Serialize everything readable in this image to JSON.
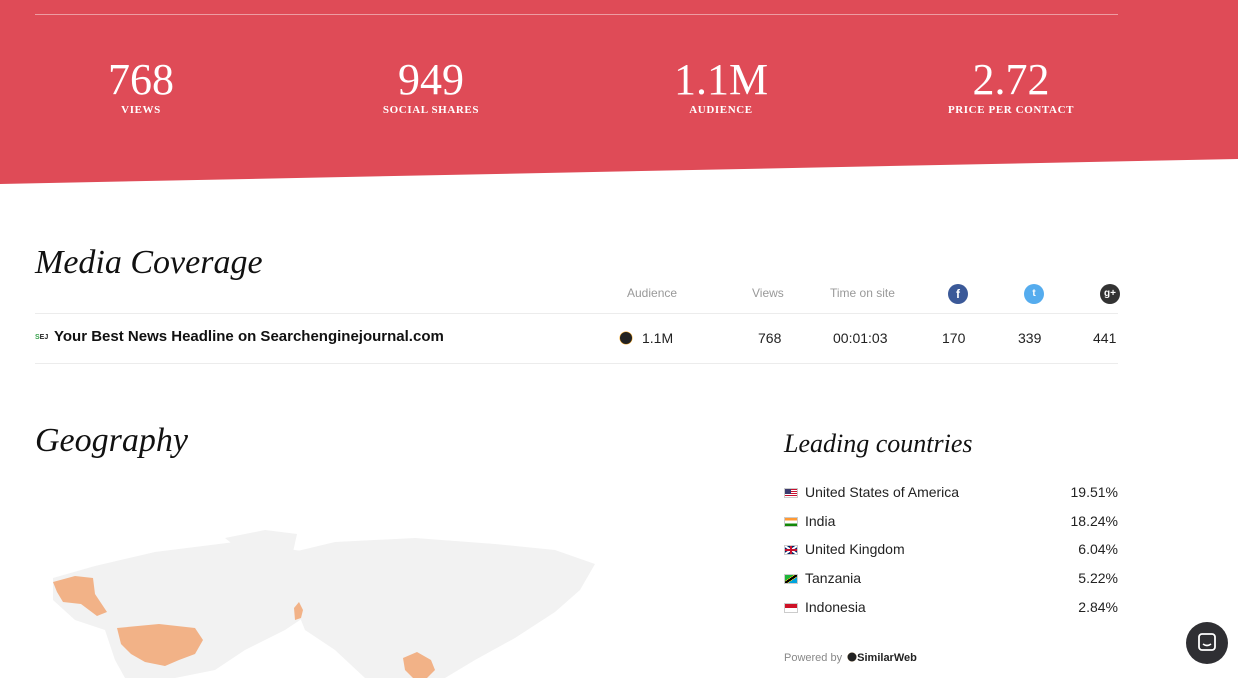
{
  "stats": [
    {
      "value": "768",
      "label": "VIEWS"
    },
    {
      "value": "949",
      "label": "SOCIAL SHARES"
    },
    {
      "value": "1.1M",
      "label": "AUDIENCE"
    },
    {
      "value": "2.72",
      "label": "PRICE PER CONTACT"
    }
  ],
  "colors": {
    "hero": "#df4b57",
    "map_land": "#f2f2f2",
    "map_highlight": "#f2b287"
  },
  "media": {
    "title": "Media Coverage",
    "headers": {
      "audience": "Audience",
      "views": "Views",
      "time": "Time on site",
      "facebook": "facebook-icon",
      "twitter": "twitter-icon",
      "google": "google-plus-icon"
    },
    "row": {
      "badge": "SEJ",
      "title": "Your Best News Headline on Searchenginejournal.com",
      "audience": "1.1M",
      "views": "768",
      "time": "00:01:03",
      "facebook": "170",
      "twitter": "339",
      "google": "441"
    }
  },
  "geography": {
    "title": "Geography",
    "leading_title": "Leading countries",
    "countries": [
      {
        "name": "United States of America",
        "pct": "19.51%"
      },
      {
        "name": "India",
        "pct": "18.24%"
      },
      {
        "name": "United Kingdom",
        "pct": "6.04%"
      },
      {
        "name": "Tanzania",
        "pct": "5.22%"
      },
      {
        "name": "Indonesia",
        "pct": "2.84%"
      }
    ],
    "powered_prefix": "Powered by",
    "powered_brand": "SimilarWeb"
  }
}
